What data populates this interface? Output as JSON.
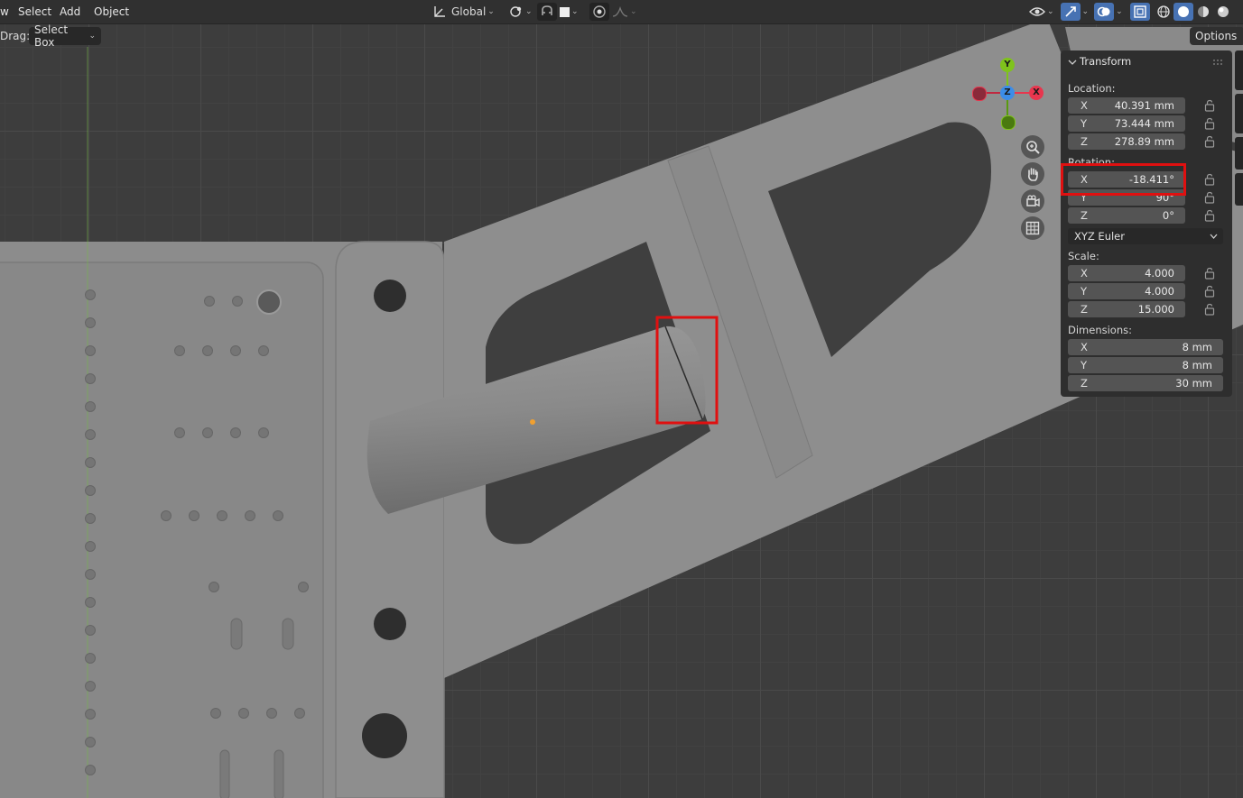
{
  "header": {
    "menu": [
      "w",
      "Select",
      "Add",
      "Object"
    ],
    "transform_orientation": "Global"
  },
  "toolbar": {
    "drag_label": "Drag:",
    "drag_value": "Select Box",
    "options_label": "Options"
  },
  "gizmo": {
    "x": "X",
    "y": "Y",
    "z": "Z"
  },
  "panel": {
    "title": "Transform",
    "location_label": "Location:",
    "location": [
      {
        "axis": "X",
        "value": "40.391 mm"
      },
      {
        "axis": "Y",
        "value": "73.444 mm"
      },
      {
        "axis": "Z",
        "value": "278.89 mm"
      }
    ],
    "rotation_label": "Rotation:",
    "rotation": [
      {
        "axis": "X",
        "value": "-18.411°"
      },
      {
        "axis": "Y",
        "value": "90°"
      },
      {
        "axis": "Z",
        "value": "0°"
      }
    ],
    "rotation_mode": "XYZ Euler",
    "scale_label": "Scale:",
    "scale": [
      {
        "axis": "X",
        "value": "4.000"
      },
      {
        "axis": "Y",
        "value": "4.000"
      },
      {
        "axis": "Z",
        "value": "15.000"
      }
    ],
    "dimensions_label": "Dimensions:",
    "dimensions": [
      {
        "axis": "X",
        "value": "8 mm"
      },
      {
        "axis": "Y",
        "value": "8 mm"
      },
      {
        "axis": "Z",
        "value": "30 mm"
      }
    ]
  },
  "colors": {
    "highlight": "#e01010",
    "accent": "#4772b3",
    "axis_x": "#e8364e",
    "axis_y": "#7fc31c",
    "axis_z": "#3c8de8"
  }
}
